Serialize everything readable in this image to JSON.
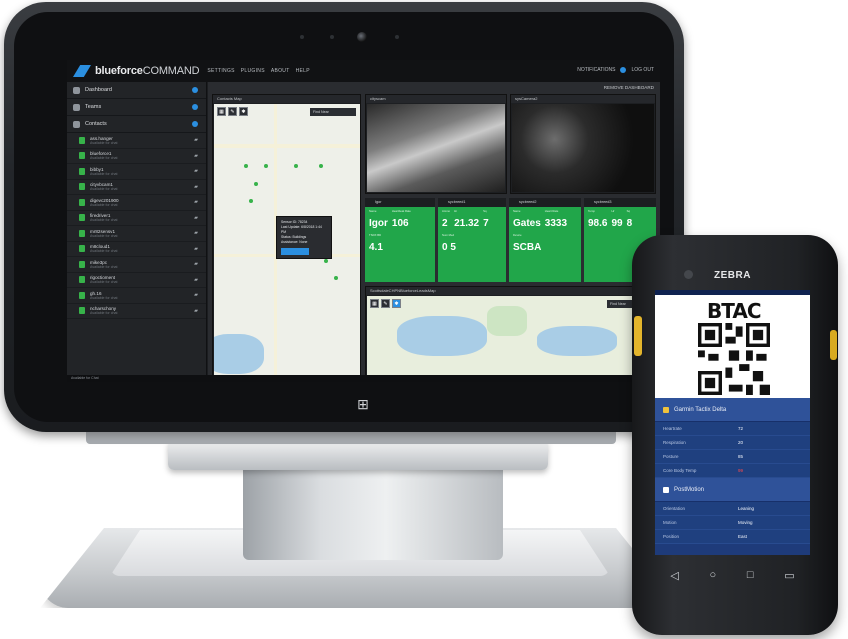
{
  "app": {
    "brand_bold": "blueforce",
    "brand_light": "COMMAND",
    "nav": [
      "SETTINGS",
      "PLUGINS",
      "ABOUT",
      "HELP"
    ],
    "notifications_label": "NOTIFICATIONS",
    "logout_label": "LOG OUT",
    "remove_dashboard_label": "REMOVE DASHBOARD",
    "status_text": "Available for Chat",
    "accent_color": "#2b8fe0",
    "tile_color": "#21a64a"
  },
  "sidebar": {
    "sections": [
      {
        "label": "Dashboard",
        "icon": "dashboard-icon"
      },
      {
        "label": "Teams",
        "icon": "team-icon"
      },
      {
        "label": "Contacts",
        "icon": "contacts-icon"
      }
    ],
    "contacts": [
      {
        "name": "ass.hanger",
        "status": "Available for chat"
      },
      {
        "name": "blueforce1",
        "status": "Available for chat"
      },
      {
        "name": "bibby1",
        "status": "Available for chat"
      },
      {
        "name": "cityvbcam1",
        "status": "Available for chat"
      },
      {
        "name": "digevc201900",
        "status": "Available for chat"
      },
      {
        "name": "firedriver1",
        "status": "Available for chat"
      },
      {
        "name": "mr82sensv1",
        "status": "Available for chat"
      },
      {
        "name": "m8cloud1",
        "status": "Available for chat"
      },
      {
        "name": "mike3pc",
        "status": "Available for chat"
      },
      {
        "name": "rigoctioment",
        "status": "Available for chat"
      },
      {
        "name": "gh.16",
        "status": "Available for chat"
      },
      {
        "name": "ncharschony",
        "status": "Available for chat"
      }
    ]
  },
  "dashboard": {
    "contacts_map_title": "Contacts Map",
    "search_label": "Find Near",
    "popup_lines": [
      "Sensor ID: 78234",
      "Last Update: 6/8/2018 1:44 PM",
      "Status: Buildings",
      "Assistance: None"
    ],
    "camera_titles": [
      "cityscam",
      "sysCamera2"
    ],
    "map2_title": "ScottsdaleCHPNBlueforceLeadsMap",
    "map_attribution": "© OpenStreetMap contributors",
    "tiles": [
      {
        "title": "Igor",
        "labels": [
          "Name",
          "Heartbeat Rate"
        ],
        "values": [
          "Igor",
          "106"
        ],
        "sub_label": "TSDX BD",
        "sub_value": "4.1"
      },
      {
        "title": "sycbreed1",
        "labels": [
          "Ammo",
          "Hr",
          "Sq"
        ],
        "values": [
          "2",
          "21.32",
          "7"
        ],
        "sub_label": "Num Med",
        "sub_value": "0  5"
      },
      {
        "title": "sycbreed2",
        "labels": [
          "Name",
          "Heart Rate"
        ],
        "values": [
          "Gates",
          "3333"
        ],
        "sub_label": "Device",
        "sub_value": "SCBA"
      },
      {
        "title": "sycbreed3",
        "labels": [
          "Temp",
          "Hr",
          "Sq"
        ],
        "values": [
          "98.6",
          "99",
          "8"
        ],
        "sub_label": "",
        "sub_value": ""
      }
    ]
  },
  "phone": {
    "brand": "ZEBRA",
    "qr_heading": "BTAC",
    "section1": "Garmin Tactix Delta",
    "metrics": [
      {
        "label": "Heartrate",
        "value": "72"
      },
      {
        "label": "Respiration",
        "value": "20"
      },
      {
        "label": "Posture",
        "value": "85"
      },
      {
        "label": "Core Body Temp",
        "value": "99"
      }
    ],
    "section2": "PostMotion",
    "motion": [
      {
        "label": "Orientation",
        "value": "Leaning"
      },
      {
        "label": "Motion",
        "value": "Moving"
      },
      {
        "label": "Position",
        "value": "East"
      }
    ],
    "nav_icons": [
      "back-icon",
      "home-icon",
      "recents-icon",
      "menu-icon"
    ]
  }
}
